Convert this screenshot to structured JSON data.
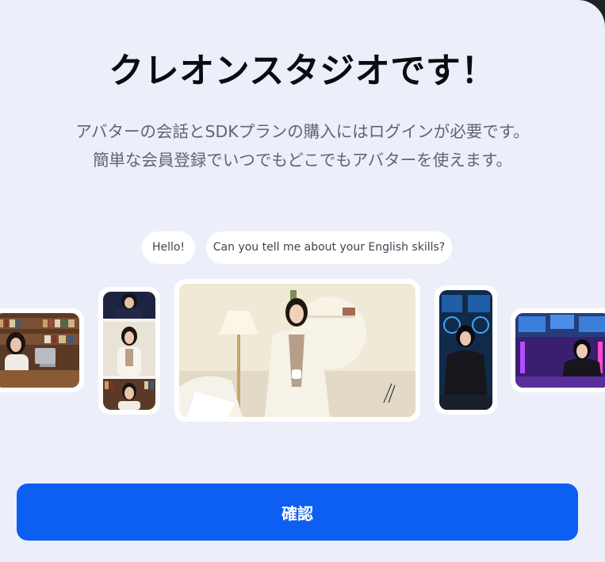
{
  "dialog": {
    "title": "クレオンスタジオです！",
    "subtitle_line1": "アバターの会話とSDKプランの購入にはログインが必要です。",
    "subtitle_line2": "簡単な会員登録でいつでもどこでもアバターを使えます。"
  },
  "chat": {
    "bubble1": "Hello!",
    "bubble2": "Can you tell me about your English skills?"
  },
  "avatars": [
    {
      "name": "library-avatar"
    },
    {
      "name": "phone-stack-avatar"
    },
    {
      "name": "living-room-avatar"
    },
    {
      "name": "gaming-phone-avatar"
    },
    {
      "name": "gaming-room-avatar"
    }
  ],
  "actions": {
    "confirm_label": "確認"
  },
  "colors": {
    "background": "#eceff9",
    "primary": "#0c5ff0",
    "title": "#0b0c10",
    "subtitle": "#5e6574"
  }
}
